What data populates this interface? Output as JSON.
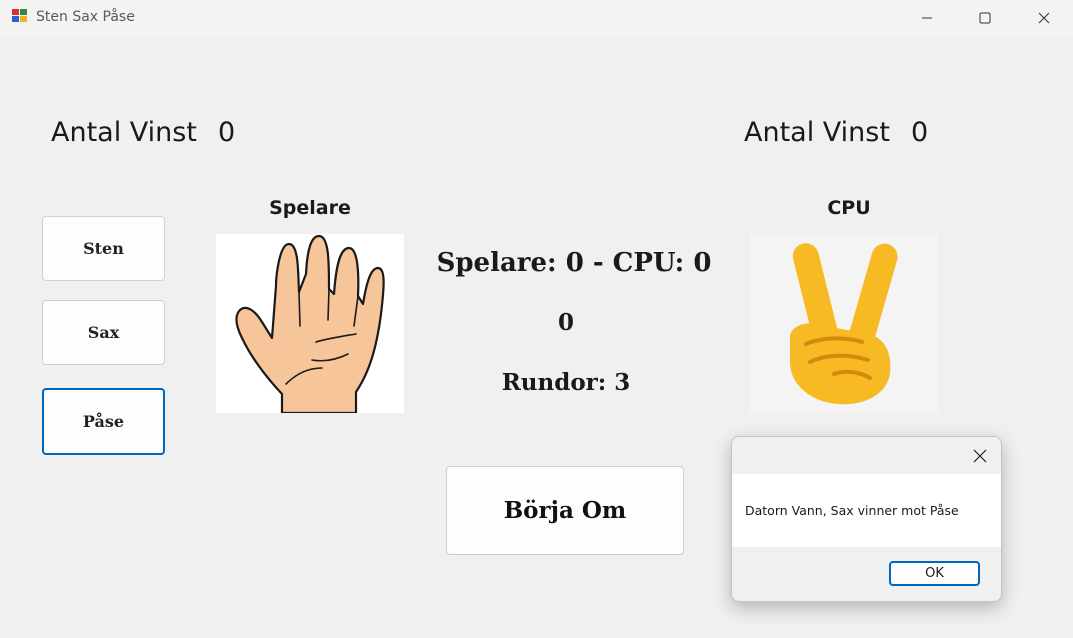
{
  "window": {
    "title": "Sten Sax Påse"
  },
  "player_panel": {
    "wins_label": "Antal Vinst",
    "wins_value": "0",
    "heading": "Spelare",
    "hand_icon": "open-hand-icon"
  },
  "cpu_panel": {
    "wins_label": "Antal Vinst",
    "wins_value": "0",
    "heading": "CPU",
    "hand_icon": "victory-hand-icon"
  },
  "choices": [
    {
      "label": "Sten"
    },
    {
      "label": "Sax"
    },
    {
      "label": "Påse"
    }
  ],
  "scoreboard": {
    "score_text": "Spelare: 0 -  CPU: 0",
    "draw_count": "0",
    "rounds_text": "Rundor: 3"
  },
  "restart_label": "Börja Om",
  "dialog": {
    "message": "Datorn Vann, Sax vinner mot Påse",
    "ok_label": "OK"
  },
  "colors": {
    "accent": "#0067c0",
    "skin": "#f7c59a",
    "emoji_yellow": "#f7b924"
  }
}
